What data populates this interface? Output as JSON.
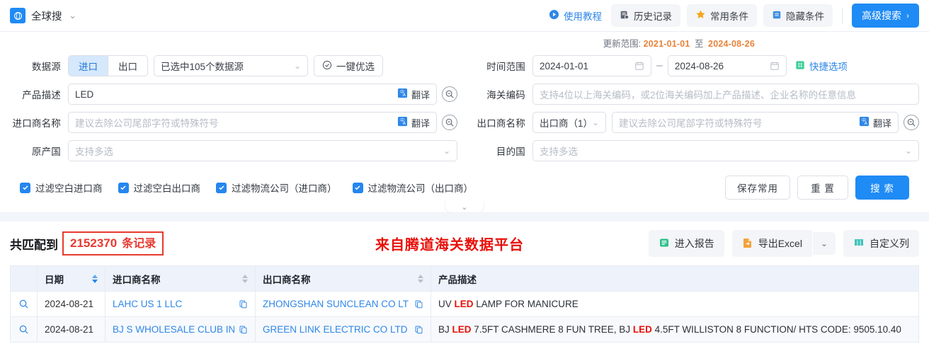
{
  "topbar": {
    "brand_name": "全球搜",
    "brand_icon": "globe-icon",
    "caret_icon": "chevron-down-icon",
    "tutorial": "使用教程",
    "history": "历史记录",
    "favorites": "常用条件",
    "hidden_conditions": "隐藏条件",
    "advanced_search": "高级搜索",
    "advanced_chevron": "›"
  },
  "update_range": {
    "label": "更新范围:",
    "start": "2021-01-01",
    "separator": "至",
    "end": "2024-08-26"
  },
  "form": {
    "datasource": {
      "label": "数据源",
      "import_tab": "进口",
      "export_tab": "出口",
      "selected_text": "已选中105个数据源",
      "optimize_button": "一键优选"
    },
    "timerange": {
      "label": "时间范围",
      "start": "2024-01-01",
      "end": "2024-08-26",
      "dash": "–",
      "quick_options": "快捷选项"
    },
    "product_desc": {
      "label": "产品描述",
      "value": "LED",
      "translate": "翻译"
    },
    "hs_code": {
      "label": "海关编码",
      "placeholder": "支持4位以上海关编码，或2位海关编码加上产品描述、企业名称的任意信息"
    },
    "importer": {
      "label": "进口商名称",
      "placeholder": "建议去除公司尾部字符或特殊符号",
      "translate": "翻译"
    },
    "exporter": {
      "label": "出口商名称",
      "select_value": "出口商（1）",
      "placeholder": "建议去除公司尾部字符或特殊符号",
      "translate": "翻译"
    },
    "origin_country": {
      "label": "原产国",
      "placeholder": "支持多选"
    },
    "dest_country": {
      "label": "目的国",
      "placeholder": "支持多选"
    }
  },
  "filters": [
    {
      "label": "过滤空白进口商",
      "checked": true
    },
    {
      "label": "过滤空白出口商",
      "checked": true
    },
    {
      "label": "过滤物流公司（进口商）",
      "checked": true
    },
    {
      "label": "过滤物流公司（出口商）",
      "checked": true
    }
  ],
  "actions": {
    "save": "保存常用",
    "reset": "重 置",
    "search": "搜 索"
  },
  "results": {
    "prefix": "共匹配到",
    "count": "2152370",
    "suffix": "条记录",
    "watermark": "来自腾道海关数据平台",
    "report_button": "进入报告",
    "export_button": "导出Excel",
    "custom_columns_button": "自定义列"
  },
  "table": {
    "columns": [
      {
        "key": "action",
        "label": "",
        "sortable": false
      },
      {
        "key": "date",
        "label": "日期",
        "sortable": true,
        "sort_active": true
      },
      {
        "key": "importer",
        "label": "进口商名称",
        "sortable": true
      },
      {
        "key": "exporter",
        "label": "出口商名称",
        "sortable": true
      },
      {
        "key": "desc",
        "label": "产品描述",
        "sortable": false
      }
    ],
    "rows": [
      {
        "date": "2024-08-21",
        "importer": "LAHC US 1 LLC",
        "exporter": "ZHONGSHAN SUNCLEAN CO LT",
        "desc_pre": "UV ",
        "desc_kw1": "LED",
        "desc_mid": " LAMP FOR MANICURE",
        "desc_kw2": "",
        "desc_post": ""
      },
      {
        "date": "2024-08-21",
        "importer": "BJ S WHOLESALE CLUB INC",
        "exporter": "GREEN LINK ELECTRIC CO LTD",
        "desc_pre": "BJ ",
        "desc_kw1": "LED",
        "desc_mid": " 7.5FT CASHMERE 8 FUN TREE, BJ ",
        "desc_kw2": "LED",
        "desc_post": " 4.5FT WILLISTON 8 FUNCTION/ HTS CODE: 9505.10.40"
      }
    ]
  },
  "colors": {
    "primary": "#1f8bf5",
    "link": "#2f87e8",
    "accent_orange": "#e8833a",
    "accent_red": "#e8110a",
    "header_bg": "#eef2fa"
  }
}
